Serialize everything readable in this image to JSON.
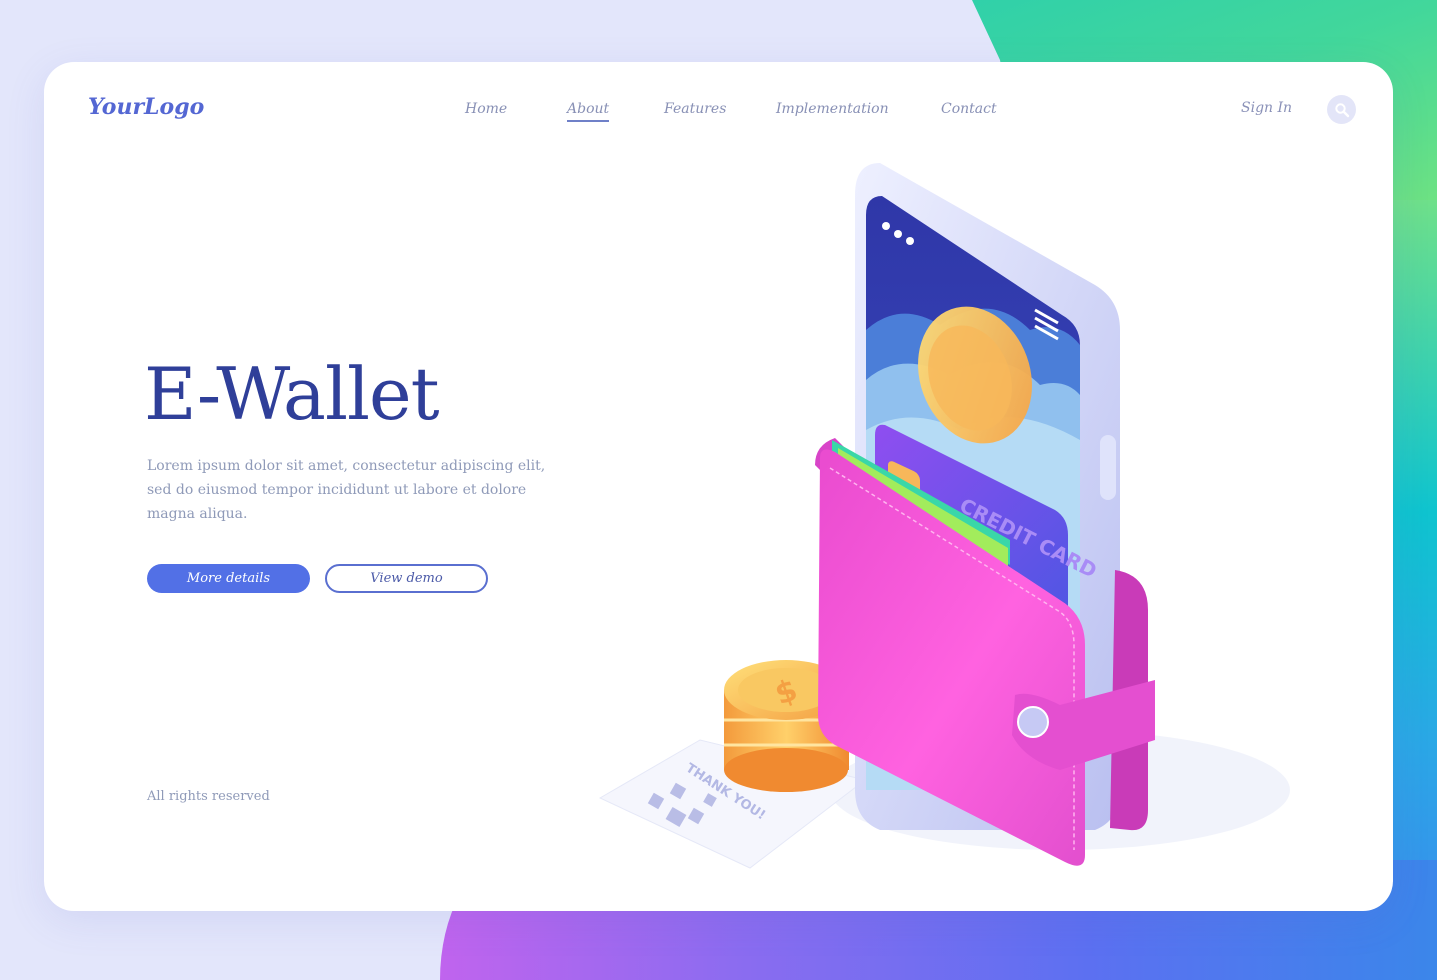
{
  "header": {
    "logo": "YourLogo",
    "nav": [
      {
        "label": "Home",
        "active": false
      },
      {
        "label": "About",
        "active": true
      },
      {
        "label": "Features",
        "active": false
      },
      {
        "label": "Implementation",
        "active": false
      },
      {
        "label": "Contact",
        "active": false
      }
    ],
    "sign_in": "Sign In",
    "search_icon": "search-icon"
  },
  "hero": {
    "title": "E-Wallet",
    "description": "Lorem ipsum dolor sit amet, consectetur adipiscing elit, sed do eiusmod tempor incididunt ut labore et dolore magna aliqua.",
    "primary_button": "More details",
    "secondary_button": "View demo"
  },
  "footer": {
    "note": "All rights reserved"
  },
  "illustration": {
    "card_label": "CREDIT CARD",
    "receipt_label": "THANK YOU!",
    "coin_symbol": "$"
  },
  "colors": {
    "accent": "#5270e6",
    "title": "#2f3f99",
    "wallet": "#f05ad8"
  }
}
